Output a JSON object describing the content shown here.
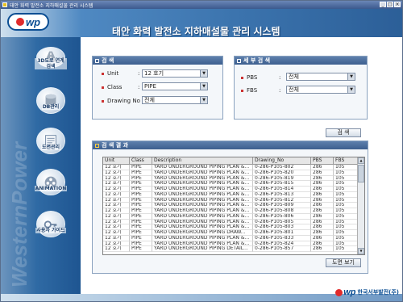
{
  "window": {
    "title": "태안 화력 발전소 지하매설물 관리 시스템"
  },
  "header": {
    "logo_text": "wp",
    "app_title": "태안 화력 발전소 지하매설물 관리 시스템"
  },
  "sidebar": {
    "brand_text": "WesternPower",
    "items": [
      {
        "label": "3D도로 연계검색",
        "icon": "3d-road-icon"
      },
      {
        "label": "DB관리",
        "icon": "database-icon"
      },
      {
        "label": "도면관리",
        "icon": "drawing-icon"
      },
      {
        "label": "ANIMATION",
        "icon": "film-reel-icon"
      },
      {
        "label": "사용자 가이드",
        "icon": "key-icon"
      }
    ]
  },
  "search": {
    "title": "검 색",
    "unit_label": "Unit",
    "unit_value": "12 호기",
    "class_label": "Class",
    "class_value": "PIPE",
    "drawing_label": "Drawing No :",
    "drawing_value": "전체"
  },
  "detail": {
    "title": "세 부 검 색",
    "pbs_label": "PBS",
    "pbs_value": "전체",
    "fbs_label": "FBS",
    "fbs_value": "전체"
  },
  "search_button": "검 색",
  "results": {
    "title": "검 색 결 과",
    "columns": [
      "Unit",
      "Class",
      "Description",
      "Drawing_No",
      "PBS",
      "FBS"
    ],
    "rows": [
      [
        "12 호기",
        "PIPE",
        "YARD UNDERGROUND PIPING PLAN &...",
        "0-286-P105-802",
        "286",
        "105"
      ],
      [
        "12 호기",
        "PIPE",
        "YARD UNDERGROUND PIPING PLAN &...",
        "0-286-P105-820",
        "286",
        "105"
      ],
      [
        "12 호기",
        "PIPE",
        "YARD UNDERGROUND PIPING PLAN &...",
        "0-286-P105-819",
        "286",
        "105"
      ],
      [
        "12 호기",
        "PIPE",
        "YARD UNDERGROUND PIPING PLAN &...",
        "0-286-P105-815",
        "286",
        "105"
      ],
      [
        "12 호기",
        "PIPE",
        "YARD UNDERGROUND PIPING PLAN &...",
        "0-286-P105-814",
        "286",
        "105"
      ],
      [
        "12 호기",
        "PIPE",
        "YARD UNDERGROUND PIPING PLAN &...",
        "0-286-P105-813",
        "286",
        "105"
      ],
      [
        "12 호기",
        "PIPE",
        "YARD UNDERGROUND PIPING PLAN &...",
        "0-286-P105-812",
        "286",
        "105"
      ],
      [
        "12 호기",
        "PIPE",
        "YARD UNDERGROUND PIPING PLAN &...",
        "0-286-P105-809",
        "286",
        "105"
      ],
      [
        "12 호기",
        "PIPE",
        "YARD UNDERGROUND PIPING PLAN &...",
        "0-286-P105-808",
        "286",
        "105"
      ],
      [
        "12 호기",
        "PIPE",
        "YARD UNDERGROUND PIPING PLAN &...",
        "0-286-P105-806",
        "286",
        "105"
      ],
      [
        "12 호기",
        "PIPE",
        "YARD UNDERGROUND PIPING PLAN &...",
        "0-286-P105-805",
        "286",
        "105"
      ],
      [
        "12 호기",
        "PIPE",
        "YARD UNDERGROUND PIPING PLAN &...",
        "0-286-P105-803",
        "286",
        "105"
      ],
      [
        "12 호기",
        "PIPE",
        "YARD UNDERGROUND PIPING DRAW...",
        "0-286-P105-801",
        "286",
        "105"
      ],
      [
        "12 호기",
        "PIPE",
        "YARD UNDERGROUND PIPING PLAN &...",
        "0-286-P105-833",
        "286",
        "105"
      ],
      [
        "12 호기",
        "PIPE",
        "YARD UNDERGROUND PIPING PLAN &...",
        "0-286-P105-824",
        "286",
        "105"
      ],
      [
        "12 호기",
        "PIPE",
        "YARD UNDERGROUND PIPING DETAIL...",
        "0-286-P105-857",
        "286",
        "105"
      ]
    ]
  },
  "view_button": "도면 보기",
  "footer": {
    "logo_text": "wp",
    "company": "한국서부발전(주)"
  },
  "colors": {
    "brand_blue": "#0b4e93",
    "brand_red": "#e12b2b",
    "panel_header": "#4a6c9a"
  }
}
